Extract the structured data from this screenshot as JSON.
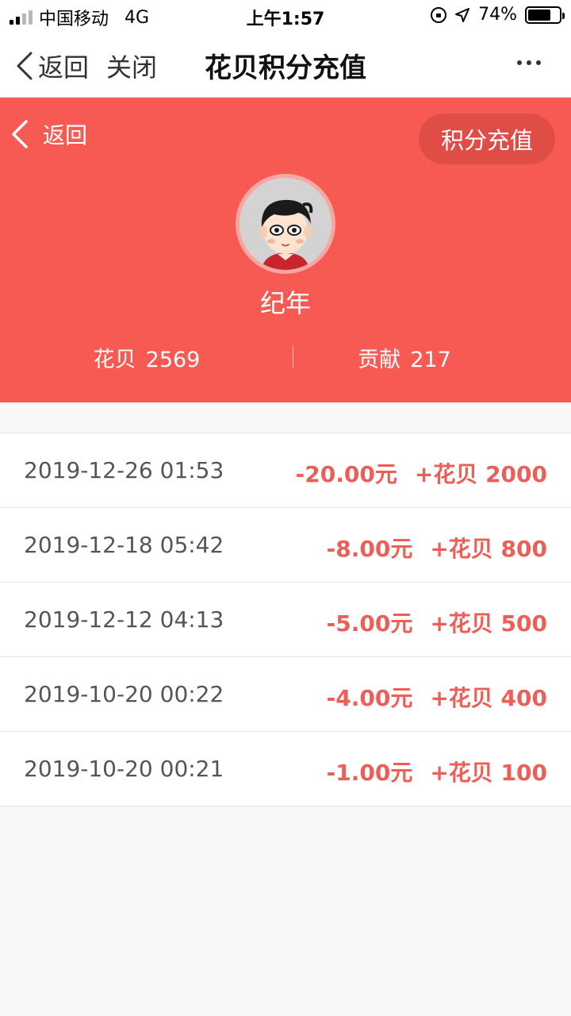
{
  "status_bar": {
    "carrier": "中国移动",
    "network": "4G",
    "time": "上午1:57",
    "battery_text": "74%",
    "battery_level": 0.74,
    "icons": [
      "signal-icon",
      "orientation-lock-icon",
      "location-icon",
      "battery-icon"
    ]
  },
  "nav": {
    "back_label": "返回",
    "close_label": "关闭",
    "title": "花贝积分充值",
    "more_icon": "more-icon"
  },
  "hero": {
    "back_label": "返回",
    "recharge_label": "积分充值",
    "username": "纪年",
    "huabei_label": "花贝",
    "huabei_value": "2569",
    "contribution_label": "贡献",
    "contribution_value": "217",
    "bg_color": "#f65a53"
  },
  "records": [
    {
      "time": "2019-12-26 01:53",
      "amount": "-20.00元",
      "points": "+花贝 2000"
    },
    {
      "time": "2019-12-18 05:42",
      "amount": "-8.00元",
      "points": "+花贝 800"
    },
    {
      "time": "2019-12-12 04:13",
      "amount": "-5.00元",
      "points": "+花贝 500"
    },
    {
      "time": "2019-10-20 00:22",
      "amount": "-4.00元",
      "points": "+花贝 400"
    },
    {
      "time": "2019-10-20 00:21",
      "amount": "-1.00元",
      "points": "+花贝 100"
    }
  ]
}
